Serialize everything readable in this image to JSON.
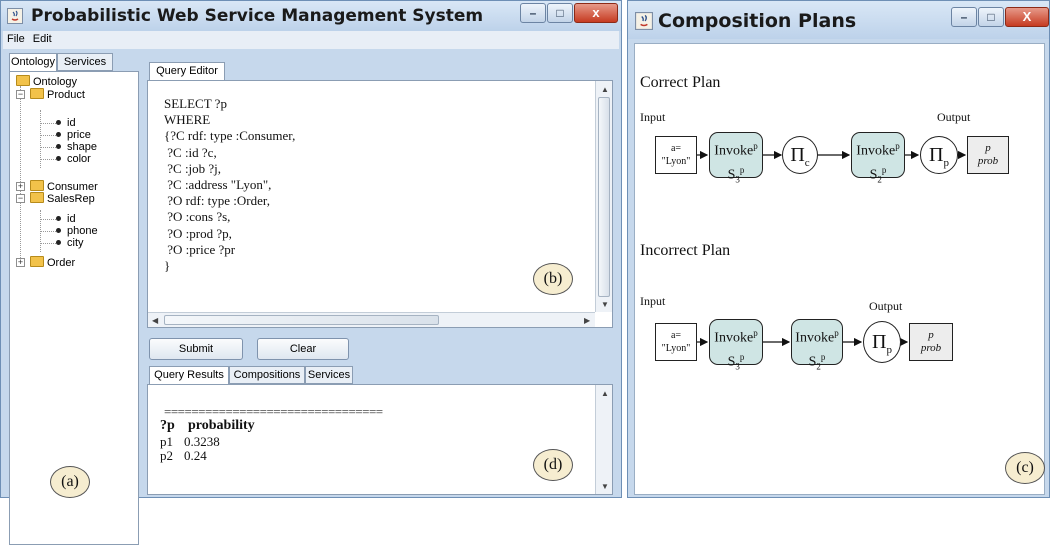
{
  "left_window": {
    "title": "Probabilistic Web Service Management System",
    "menu": [
      "File",
      "Edit"
    ],
    "left_tabs": [
      "Ontology",
      "Services"
    ],
    "tree": {
      "root": "Ontology",
      "product": "Product",
      "product_props": [
        "id",
        "price",
        "shape",
        "color"
      ],
      "consumer": "Consumer",
      "salesrep": "SalesRep",
      "salesrep_props": [
        "id",
        "phone",
        "city"
      ],
      "order": "Order"
    },
    "editor_tab": "Query Editor",
    "query_lines": [
      "SELECT ?p",
      "WHERE",
      "{?C rdf: type :Consumer,",
      " ?C :id ?c,",
      " ?C :job ?j,",
      " ?C :address \"Lyon\",",
      " ?O rdf: type :Order,",
      " ?O :cons ?s,",
      " ?O :prod ?p,",
      " ?O :price ?pr",
      "}"
    ],
    "submit_label": "Submit",
    "clear_label": "Clear",
    "result_tabs": [
      "Query Results",
      "Compositions",
      "Services"
    ],
    "results_separator": "================================",
    "results_header": {
      "col1": "?p",
      "col2": "probability"
    },
    "results_rows": [
      {
        "p": "p1",
        "prob": "0.3238"
      },
      {
        "p": "p2",
        "prob": "0.24"
      }
    ],
    "label_a": "(a)",
    "label_b": "(b)",
    "label_d": "(d)",
    "window_buttons": [
      "–",
      "□",
      "x"
    ]
  },
  "right_window": {
    "title": "Composition Plans",
    "correct_plan_title": "Correct Plan",
    "incorrect_plan_title": "Incorrect Plan",
    "input_label": "Input",
    "output_label": "Output",
    "input_node": {
      "line1": "a=",
      "line2": "\"Lyon\""
    },
    "invoke_word": "Invoke",
    "invoke_sup": "p",
    "service_s3": "S",
    "s3_sub": "3",
    "s2_sub": "2",
    "pi_symbol": "Π",
    "pi_c_sub": "c",
    "pi_p_sub": "p",
    "output_node": {
      "line1": "p",
      "line2": "prob"
    },
    "label_c": "(c)",
    "window_buttons": [
      "–",
      "□",
      "X"
    ]
  },
  "colors": {
    "window_frame": "#c6d8ec",
    "invoke_fill": "#cfe5e4",
    "output_fill": "#ededed",
    "label_circle_fill": "#f6edd0",
    "close_button": "#c63b21"
  }
}
